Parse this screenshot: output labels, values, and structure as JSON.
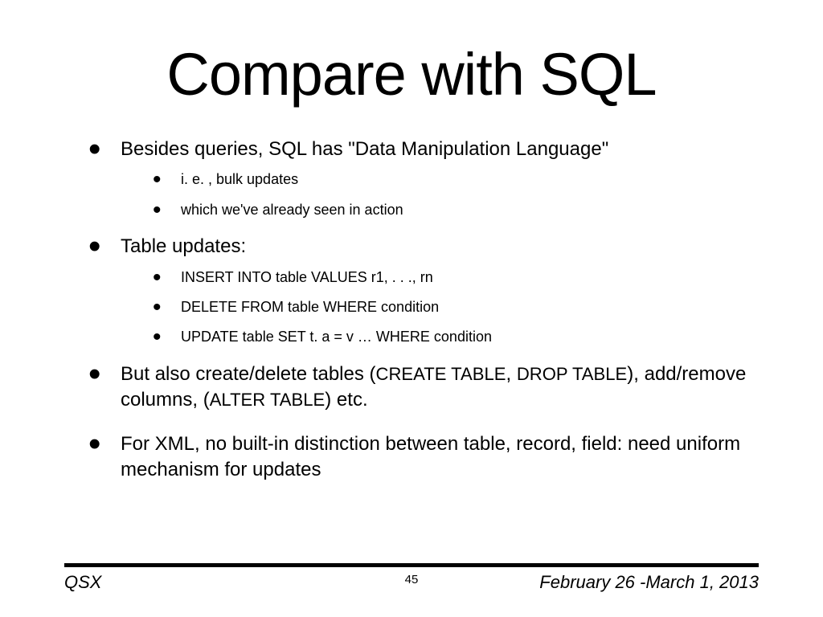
{
  "title": "Compare with SQL",
  "bullets": {
    "b1": {
      "text": "Besides queries, SQL has \"Data Manipulation Language\"",
      "sub": {
        "s1": "i. e. , bulk updates",
        "s2": "which we've already seen in action"
      }
    },
    "b2": {
      "text": "Table updates:",
      "sub": {
        "s1": "INSERT INTO table VALUES r1, . . ., rn",
        "s2": "DELETE FROM table WHERE condition",
        "s3": "UPDATE table SET t. a = v … WHERE condition"
      }
    },
    "b3": {
      "text_part1": "But also create/delete tables (",
      "sql1": "CREATE TABLE",
      "text_part2": ", ",
      "sql2": "DROP TABLE",
      "text_part3": "), add/remove columns, (",
      "sql3": "ALTER TABLE",
      "text_part4": ") etc."
    },
    "b4": {
      "text": "For XML, no built-in distinction between table, record, field: need uniform mechanism for updates"
    }
  },
  "footer": {
    "left": "QSX",
    "right": "February 26 -March 1, 2013",
    "page": "45"
  }
}
